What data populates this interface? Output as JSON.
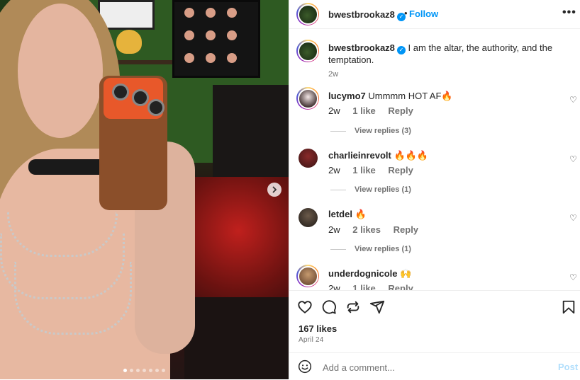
{
  "post": {
    "username": "bwestbrookaz8",
    "follow_label": "Follow",
    "separator": "•",
    "more_label": "•••",
    "caption_text": "I am the altar, the authority, and the temptation.",
    "caption_time": "2w",
    "likes_text": "167 likes",
    "date": "April 24"
  },
  "media": {
    "carousel_count": 7,
    "active_index": 0
  },
  "comments": [
    {
      "username": "lucymo7",
      "text": "Ummmm HOT AF🔥",
      "time": "2w",
      "likes": "1 like",
      "reply_label": "Reply",
      "view_replies": "View replies (3)"
    },
    {
      "username": "charlieinrevolt",
      "text": "🔥🔥🔥",
      "time": "2w",
      "likes": "1 like",
      "reply_label": "Reply",
      "view_replies": "View replies (1)"
    },
    {
      "username": "letdel",
      "text": "🔥",
      "time": "2w",
      "likes": "2 likes",
      "reply_label": "Reply",
      "view_replies": "View replies (1)"
    },
    {
      "username": "underdognicole",
      "text": "🙌",
      "time": "2w",
      "likes": "1 like",
      "reply_label": "Reply"
    }
  ],
  "composer": {
    "placeholder": "Add a comment...",
    "post_label": "Post"
  },
  "icons": {
    "like": "heart-icon",
    "comment": "comment-icon",
    "share": "repost-icon",
    "send": "send-icon",
    "save": "bookmark-icon",
    "emoji": "emoji-icon",
    "next": "chevron-right-icon",
    "verified": "verified-badge-icon"
  },
  "colors": {
    "link": "#0095f6",
    "post_disabled": "#b2dffc",
    "muted": "#737373"
  }
}
